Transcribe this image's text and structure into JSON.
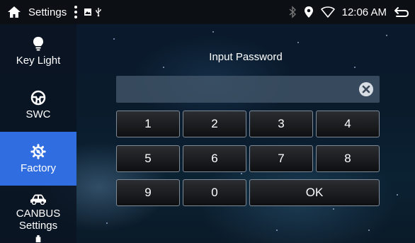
{
  "statusbar": {
    "title": "Settings",
    "time": "12:06 AM",
    "icons": [
      "home-icon",
      "more-vert-icon",
      "image-notification-icon",
      "usb-icon",
      "bluetooth-icon",
      "location-icon",
      "wifi-icon",
      "back-icon"
    ]
  },
  "sidebar": {
    "items": [
      {
        "label": "Key Light",
        "icon": "lightbulb-icon"
      },
      {
        "label": "SWC",
        "icon": "steering-wheel-icon"
      },
      {
        "label": "Factory",
        "icon": "gear-icon",
        "active": true
      },
      {
        "label": "CANBUS Settings",
        "icon": "car-icon"
      }
    ]
  },
  "password": {
    "title": "Input Password",
    "value": ""
  },
  "keypad": {
    "keys": [
      "1",
      "2",
      "3",
      "4",
      "5",
      "6",
      "7",
      "8",
      "9",
      "0",
      "OK"
    ]
  },
  "colors": {
    "accent": "#2f6de0",
    "statusbar_bg": "#0c0f14",
    "key_border": "#7e8a98"
  }
}
